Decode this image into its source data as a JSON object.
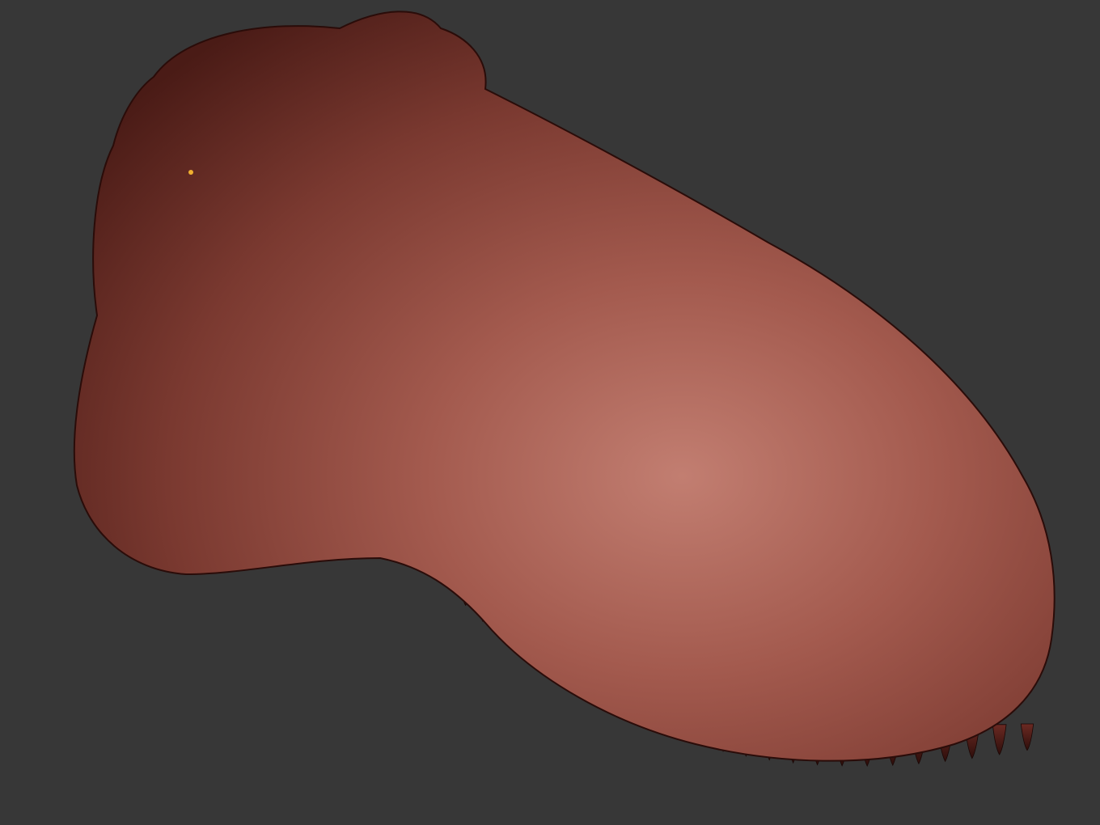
{
  "viewport": {
    "background_color": "#373737",
    "model": {
      "subject": "dinosaur-skull",
      "render_mode": "wireframe-on-shaded",
      "surface_base_color": "#8a3d34",
      "surface_highlight_color": "#c07a6d",
      "surface_shadow_color": "#3e1512",
      "wireframe_color": "#1a0705",
      "marker_color": "#f0b030"
    }
  }
}
